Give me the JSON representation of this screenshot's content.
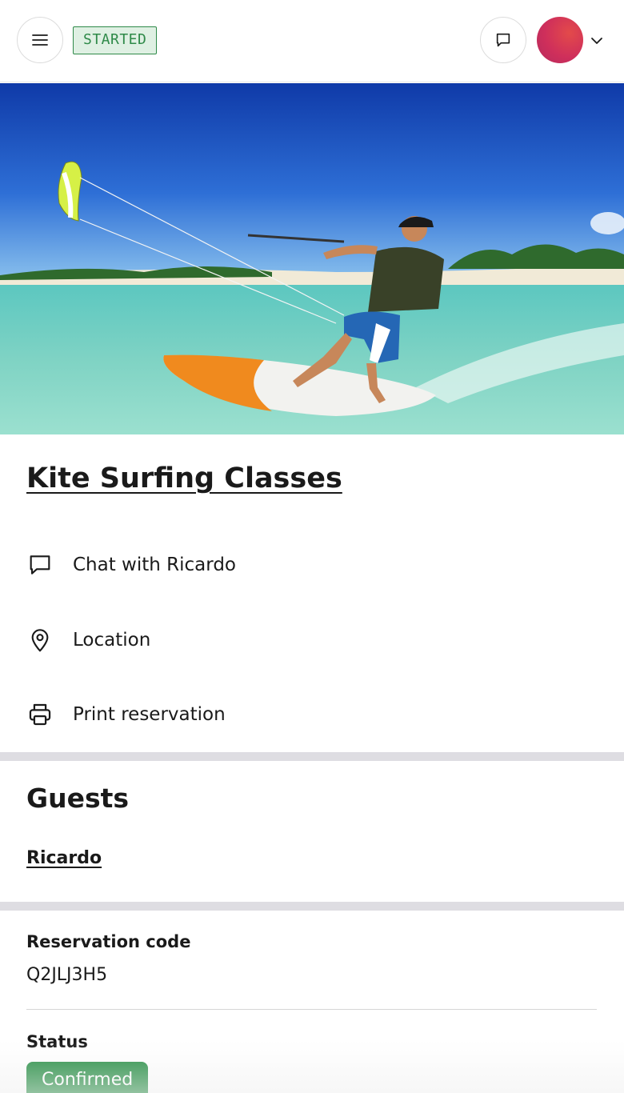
{
  "header": {
    "status_badge": "STARTED",
    "menu_icon": "hamburger-menu-icon",
    "chat_icon": "chat-bubble-icon",
    "avatar_color": "#cf2f5b",
    "dropdown_icon": "chevron-down-icon"
  },
  "hero": {
    "image_icon": "hero-image"
  },
  "listing": {
    "title": "Kite Surfing Classes",
    "actions": [
      {
        "icon": "chat-bubble-icon",
        "label": "Chat with Ricardo"
      },
      {
        "icon": "map-pin-icon",
        "label": "Location"
      },
      {
        "icon": "printer-icon",
        "label": "Print reservation"
      }
    ]
  },
  "guests": {
    "heading": "Guests",
    "names": [
      "Ricardo"
    ]
  },
  "reservation": {
    "code_label": "Reservation code",
    "code": "Q2JLJ3H5",
    "status_label": "Status",
    "status": "Confirmed",
    "status_color": "#1f8a3e"
  },
  "colors": {
    "badge_text": "#2f8a49",
    "badge_bg": "#dff0e3",
    "divider": "#dedde2"
  }
}
